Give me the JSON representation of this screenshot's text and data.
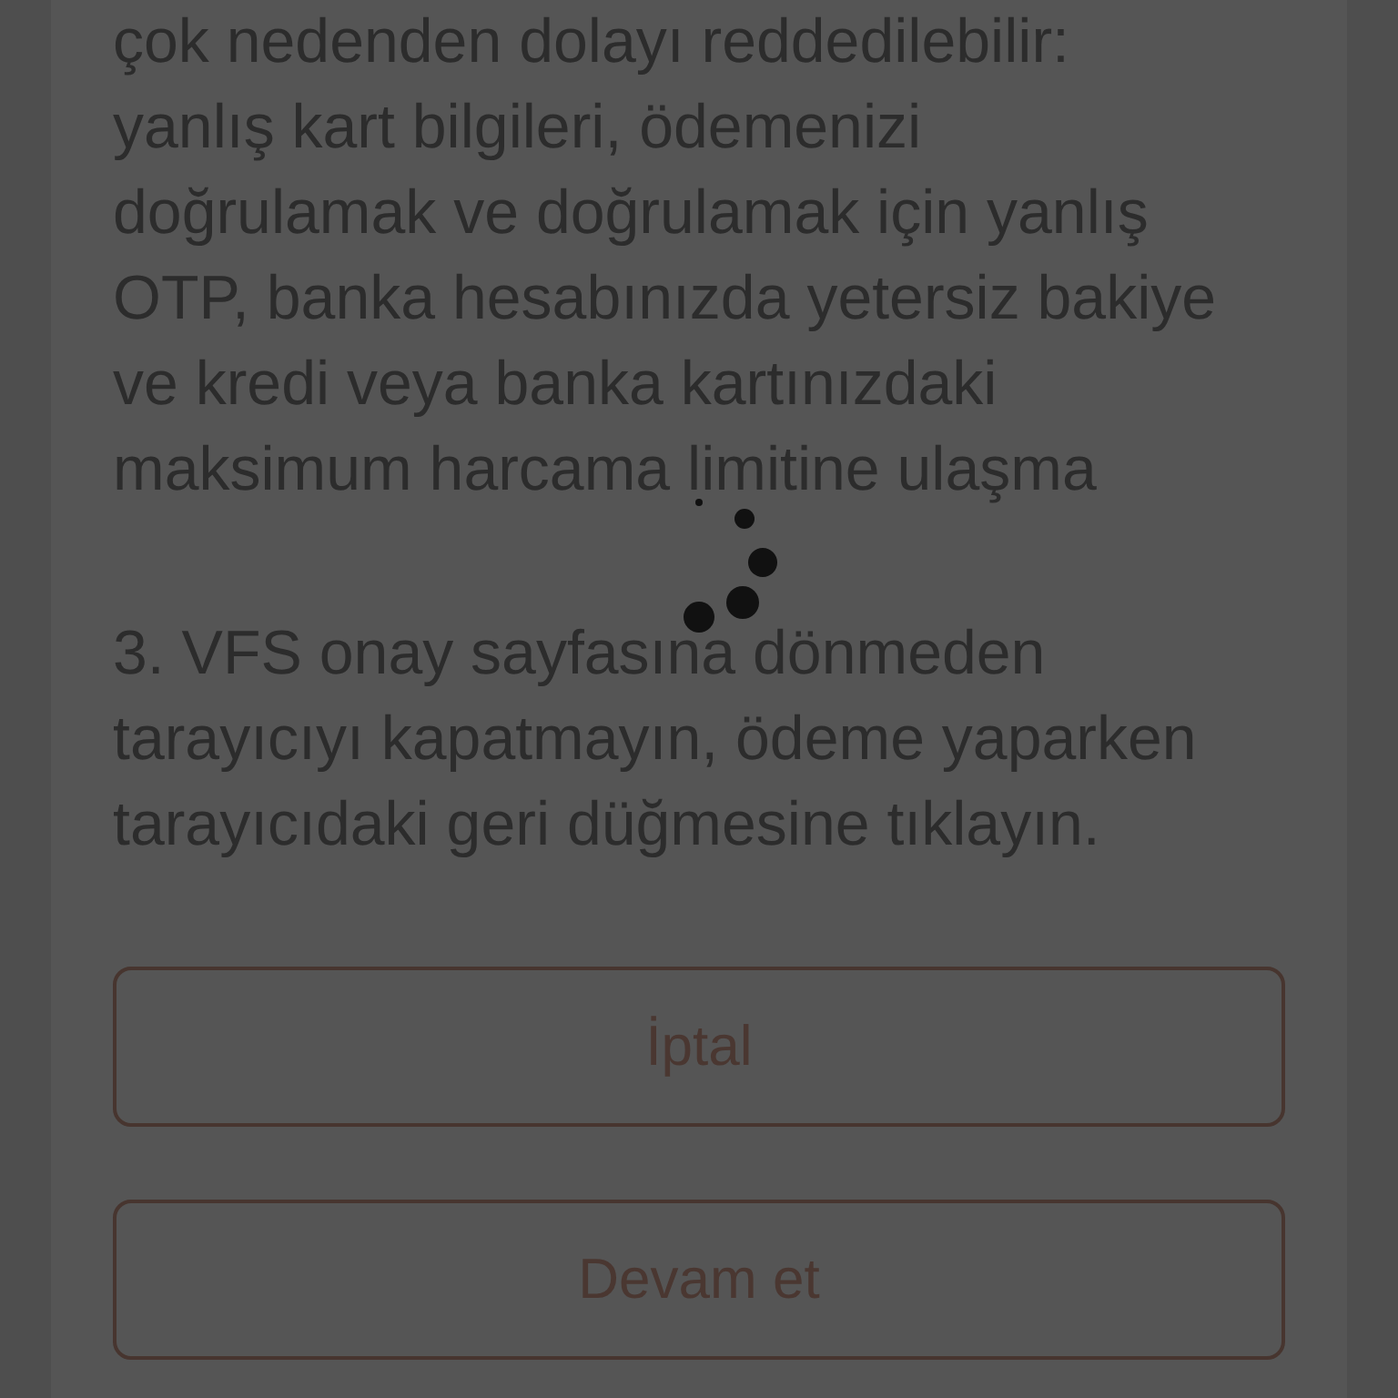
{
  "paragraphs": [
    "çok nedenden dolayı reddedilebilir: yanlış kart bilgileri, ödemenizi doğrulamak ve doğrulamak için yanlış OTP, banka hesabınızda yetersiz bakiye ve kredi veya banka kartınızdaki maksimum harcama limitine ulaşma",
    "3. VFS onay sayfasına dönmeden tarayıcıyı kapatmayın, ödeme yaparken tarayıcıdaki geri düğmesine tıklayın."
  ],
  "loading": true,
  "buttons": [
    {
      "label": "İptal"
    },
    {
      "label": "Devam et"
    }
  ]
}
